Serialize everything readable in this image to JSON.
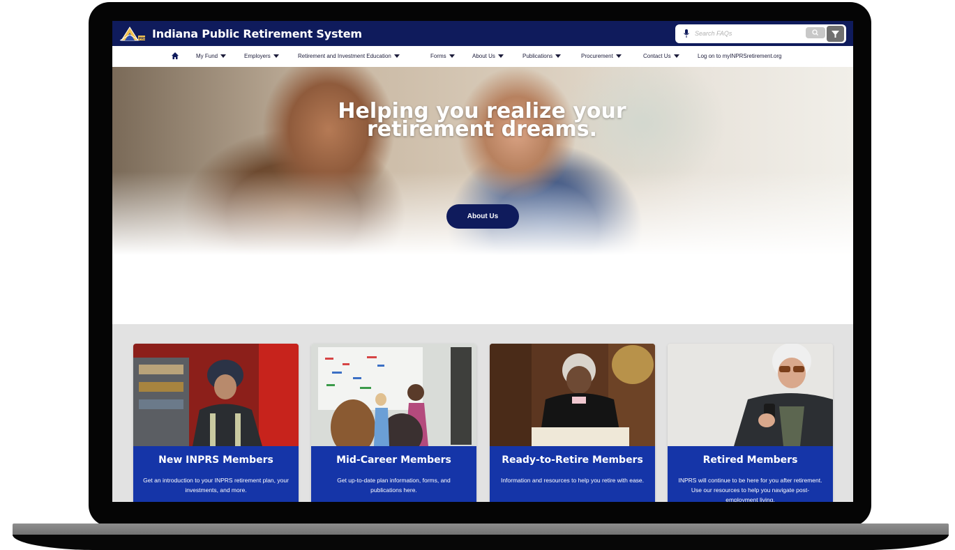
{
  "header": {
    "site_title": "Indiana Public Retirement System",
    "search_placeholder": "Search FAQs"
  },
  "nav": {
    "items": [
      {
        "label": "My Fund"
      },
      {
        "label": "Employers"
      },
      {
        "label": "Retirement and Investment Education"
      },
      {
        "label": "Forms"
      },
      {
        "label": "About Us"
      },
      {
        "label": "Publications"
      },
      {
        "label": "Procurement"
      },
      {
        "label": "Contact Us"
      },
      {
        "label": "Log on to myINPRSretirement.org"
      }
    ]
  },
  "hero": {
    "headline_line1": "Helping you realize your",
    "headline_line2": "retirement dreams.",
    "button_label": "About Us"
  },
  "cards": [
    {
      "title": "New INPRS Members",
      "text": "Get an introduction to your INPRS retirement plan, your investments, and more."
    },
    {
      "title": "Mid-Career Members",
      "text": "Get up-to-date plan information, forms, and publications here."
    },
    {
      "title": "Ready-to-Retire Members",
      "text": "Information and resources to help you retire with ease."
    },
    {
      "title": "Retired Members",
      "text": "INPRS will continue to be here for you after retirement. Use our resources to help you navigate post-employment living."
    }
  ],
  "colors": {
    "brand_navy": "#0f1b5c",
    "card_blue": "#1535a8",
    "section_gray": "#e2e2e2"
  }
}
